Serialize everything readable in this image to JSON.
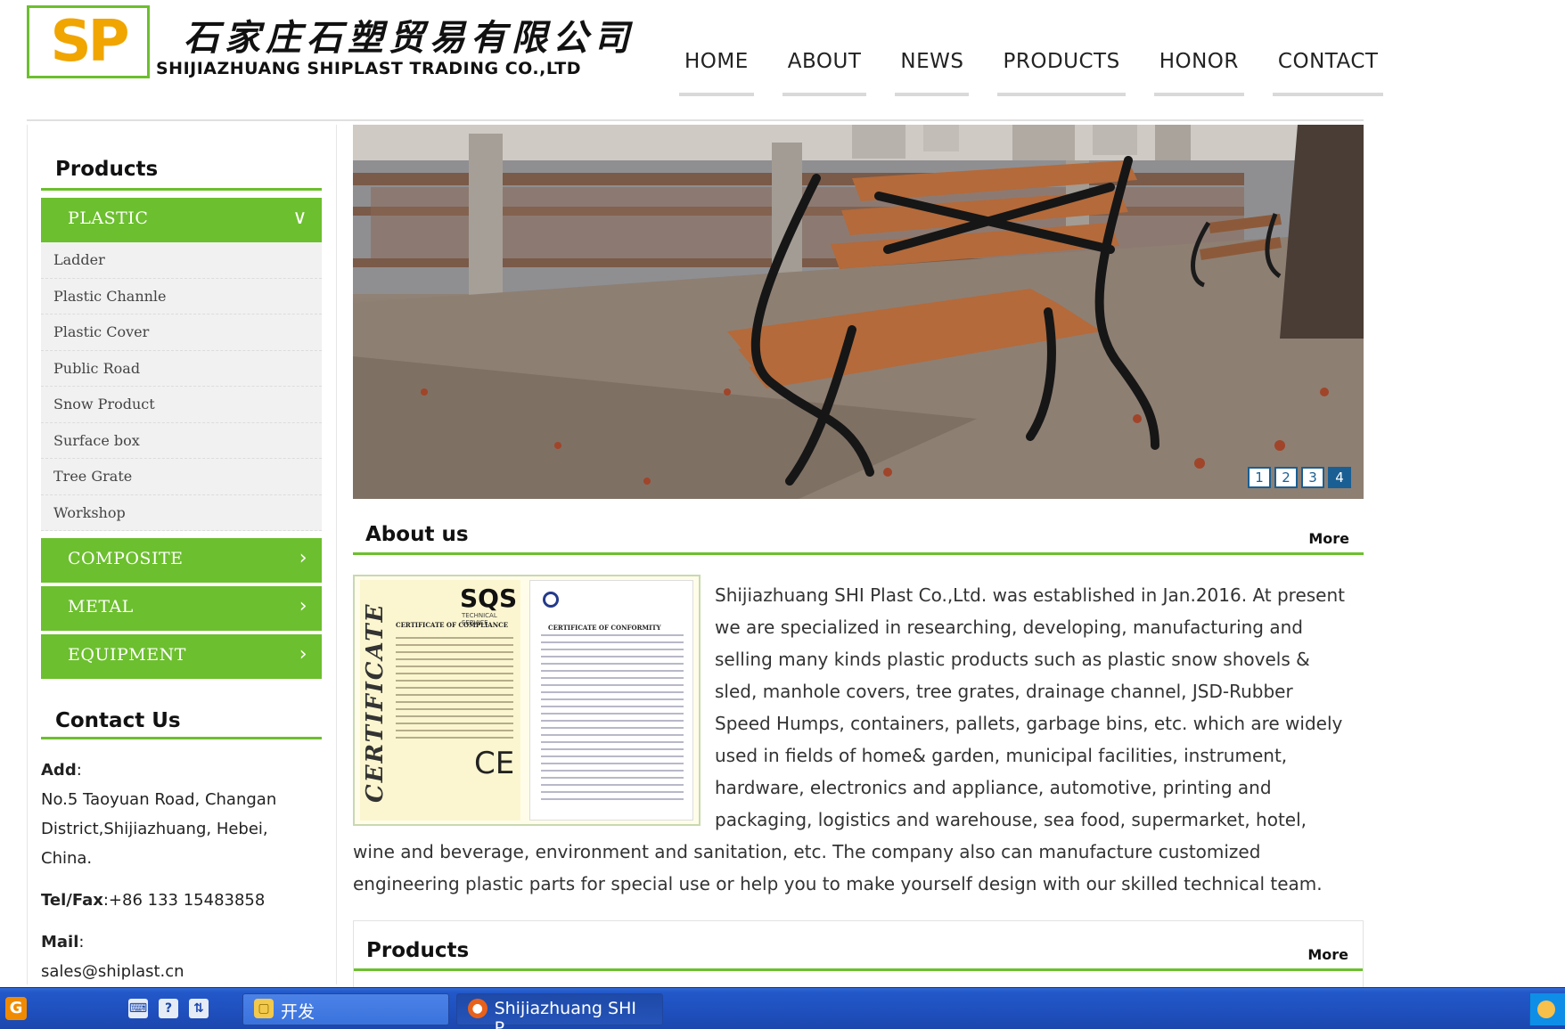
{
  "header": {
    "logo_text": "SP",
    "company_cn": "石家庄石塑贸易有限公司",
    "company_en": "SHIJIAZHUANG SHIPLAST TRADING CO.,LTD",
    "nav": [
      "HOME",
      "ABOUT",
      "NEWS",
      "PRODUCTS",
      "HONOR",
      "CONTACT"
    ]
  },
  "sidebar": {
    "products_heading": "Products",
    "plastic": {
      "label": "PLASTIC",
      "items": [
        "Ladder",
        "Plastic Channle",
        "Plastic Cover",
        "Public Road",
        "Snow Product",
        "Surface box",
        "Tree Grate",
        "Workshop"
      ]
    },
    "composite_label": "COMPOSITE",
    "metal_label": "METAL",
    "equipment_label": "EQUIPMENT",
    "contact_heading": "Contact Us",
    "contact": {
      "add_label": "Add",
      "add_lines": [
        "No.5 Taoyuan Road, Changan",
        "District,Shijiazhuang, Hebei,",
        "China."
      ],
      "tel_label": "Tel/Fax",
      "tel_value": "+86 133 15483858",
      "mail_label": "Mail",
      "mail_value": "sales@shiplast.cn"
    }
  },
  "banner": {
    "pages": [
      "1",
      "2",
      "3",
      "4"
    ],
    "active_page": 4
  },
  "about": {
    "title": "About us",
    "more": "More",
    "cert": {
      "sqs": "SQS",
      "sqs_sub": "TECHNICAL SERVICE",
      "word": "CERTIFICATE",
      "ce": "CE",
      "title_a": "CERTIFICATE OF COMPLIANCE",
      "title_b": "CERTIFICATE OF CONFORMITY"
    },
    "text_lines_wrapped": [
      "Shijiazhuang SHI Plast Co.,Ltd. was established in Jan.2016. At present",
      "we are specialized in researching, developing, manufacturing and",
      "selling many kinds plastic products such as plastic snow shovels &",
      "sled, manhole covers, tree grates, drainage channel, JSD-Rubber",
      "Speed Humps, containers, pallets, garbage bins, etc. which are widely",
      "used in fields of home& garden, municipal facilities, instrument,",
      "hardware, electronics and appliance, automotive, printing and",
      "packaging, logistics and warehouse, sea food, supermarket, hotel,"
    ],
    "text_lines_full": [
      "wine and beverage, environment and sanitation, etc. The company also can manufacture customized",
      "engineering plastic parts for special use or help you to make yourself design with our skilled technical team."
    ]
  },
  "products_section": {
    "title": "Products",
    "more": "More"
  },
  "taskbar": {
    "start_glyph": "G",
    "quick_icons": [
      "keyboard-icon",
      "help-icon",
      "network-icon"
    ],
    "folder_label": "开发",
    "browser_label": "Shijiazhuang SHI P..."
  },
  "colors": {
    "accent_green": "#6cbf2e",
    "logo_orange": "#f0a500",
    "pager_blue": "#1a5f93",
    "taskbar_blue": "#1f4fbd"
  }
}
